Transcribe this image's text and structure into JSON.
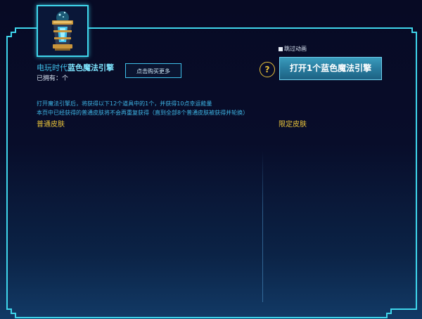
{
  "item": {
    "icon": "blue-magic-engine-lantern-icon",
    "title_prefix": "电玩时代",
    "title_highlight": "蓝色魔法引擎",
    "owned_text": "已拥有：个"
  },
  "actions": {
    "buy_more_label": "点击购买更多",
    "skip_animation_label": "跳过动画",
    "help_label": "?",
    "open_button_label": "打开1个蓝色魔法引擎"
  },
  "description": {
    "line1": "打开魔法引擎后，将获得以下12个道具中的1个，并获得10点幸运能量",
    "line2": "本页中已经获得的普通皮肤将不会再重复获得（直到全部8个普通皮肤被获得并轮换）"
  },
  "sections": {
    "normal_skins": "普通皮肤",
    "limited_skins": "限定皮肤"
  },
  "colors": {
    "frame": "#3fd6ec",
    "accent_text": "#3fc0ea",
    "section_gold": "#e8c23a",
    "button_blue": "#2a7fa2"
  }
}
